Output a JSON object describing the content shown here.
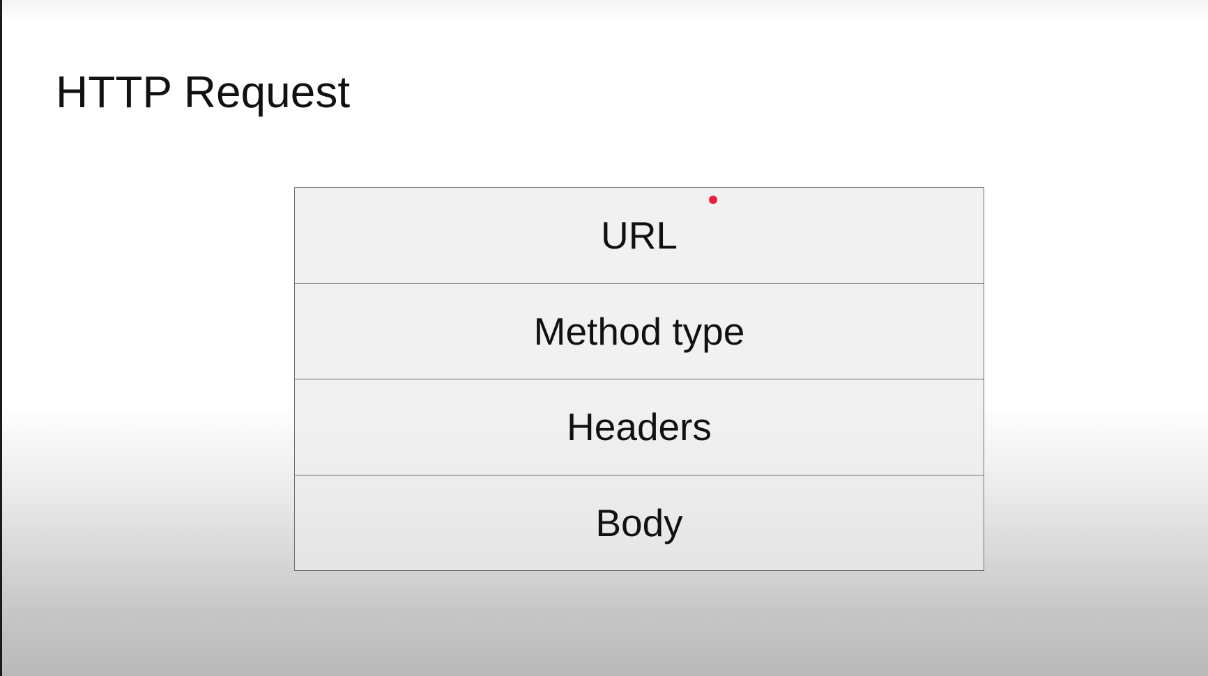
{
  "slide": {
    "title": "HTTP Request"
  },
  "request_parts": [
    {
      "label": "URL"
    },
    {
      "label": "Method type"
    },
    {
      "label": "Headers"
    },
    {
      "label": "Body"
    }
  ],
  "colors": {
    "pointer": "#e8203c",
    "border": "#6f6f6f",
    "text": "#111111"
  }
}
